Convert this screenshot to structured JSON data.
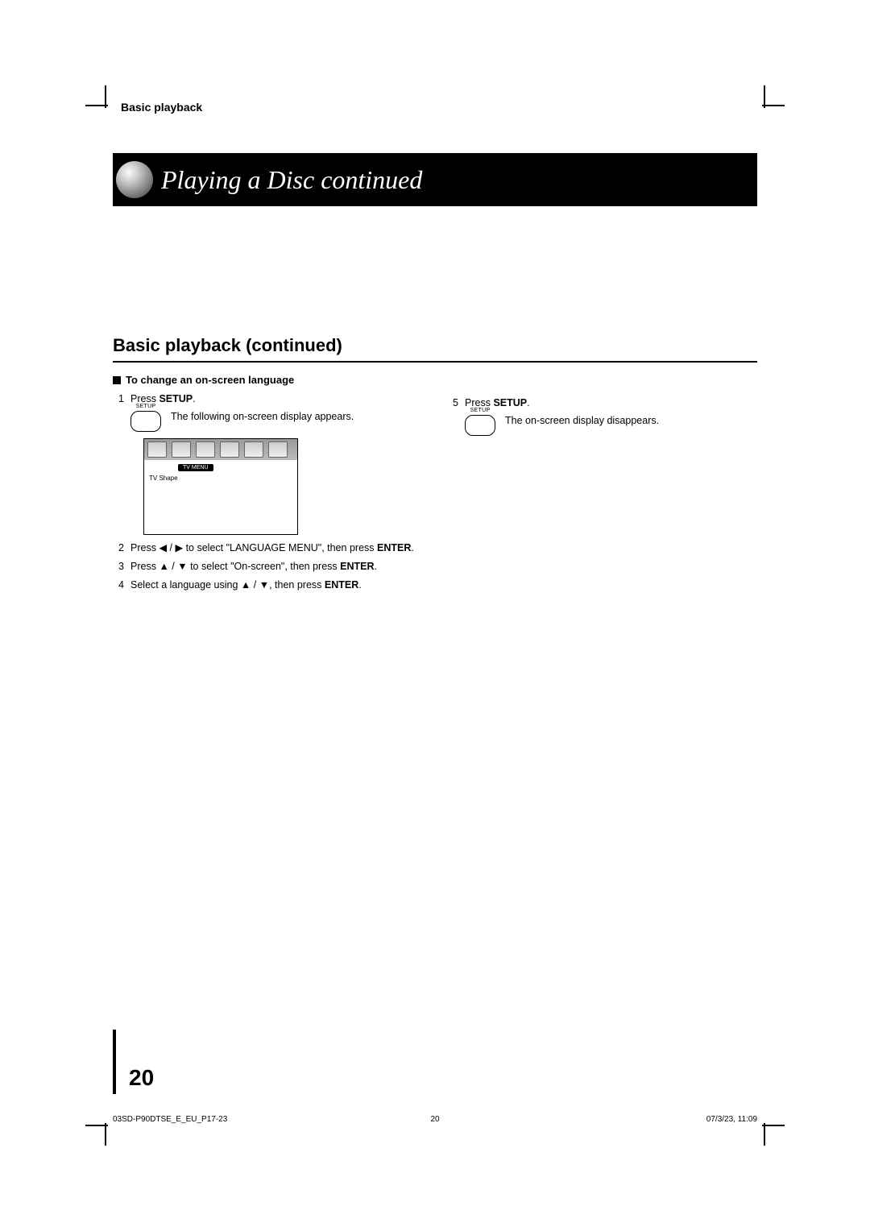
{
  "header": {
    "section_label": "Basic playback",
    "title": "Playing a Disc continued"
  },
  "section": {
    "heading": "Basic playback (continued)",
    "subheading": "To change an on-screen language"
  },
  "left_steps": {
    "s1_num": "1",
    "s1_prefix": "Press ",
    "s1_bold": "SETUP",
    "s1_suffix": ".",
    "s1_note": "The following on-screen display appears.",
    "osd_label": "TV MENU",
    "osd_item": "TV Shape",
    "s2_num": "2",
    "s2_prefix": "Press  ",
    "s2_arrows": "◀ / ▶",
    "s2_mid": " to select \"LANGUAGE MENU\", then press ",
    "s2_bold": "ENTER",
    "s2_suffix": ".",
    "s3_num": "3",
    "s3_prefix": "Press ",
    "s3_arrows": "▲ / ▼",
    "s3_mid": " to select \"On-screen\", then press ",
    "s3_bold": "ENTER",
    "s3_suffix": ".",
    "s4_num": "4",
    "s4_prefix": "Select a language using ",
    "s4_arrows": "▲ / ▼",
    "s4_mid": ", then press ",
    "s4_bold": "ENTER",
    "s4_suffix": "."
  },
  "right_steps": {
    "s5_num": "5",
    "s5_prefix": "Press ",
    "s5_bold": "SETUP",
    "s5_suffix": ".",
    "s5_note": "The on-screen display disappears."
  },
  "page_number": "20",
  "footer": {
    "left": "03SD-P90DTSE_E_EU_P17-23",
    "center": "20",
    "right": "07/3/23, 11:09"
  }
}
